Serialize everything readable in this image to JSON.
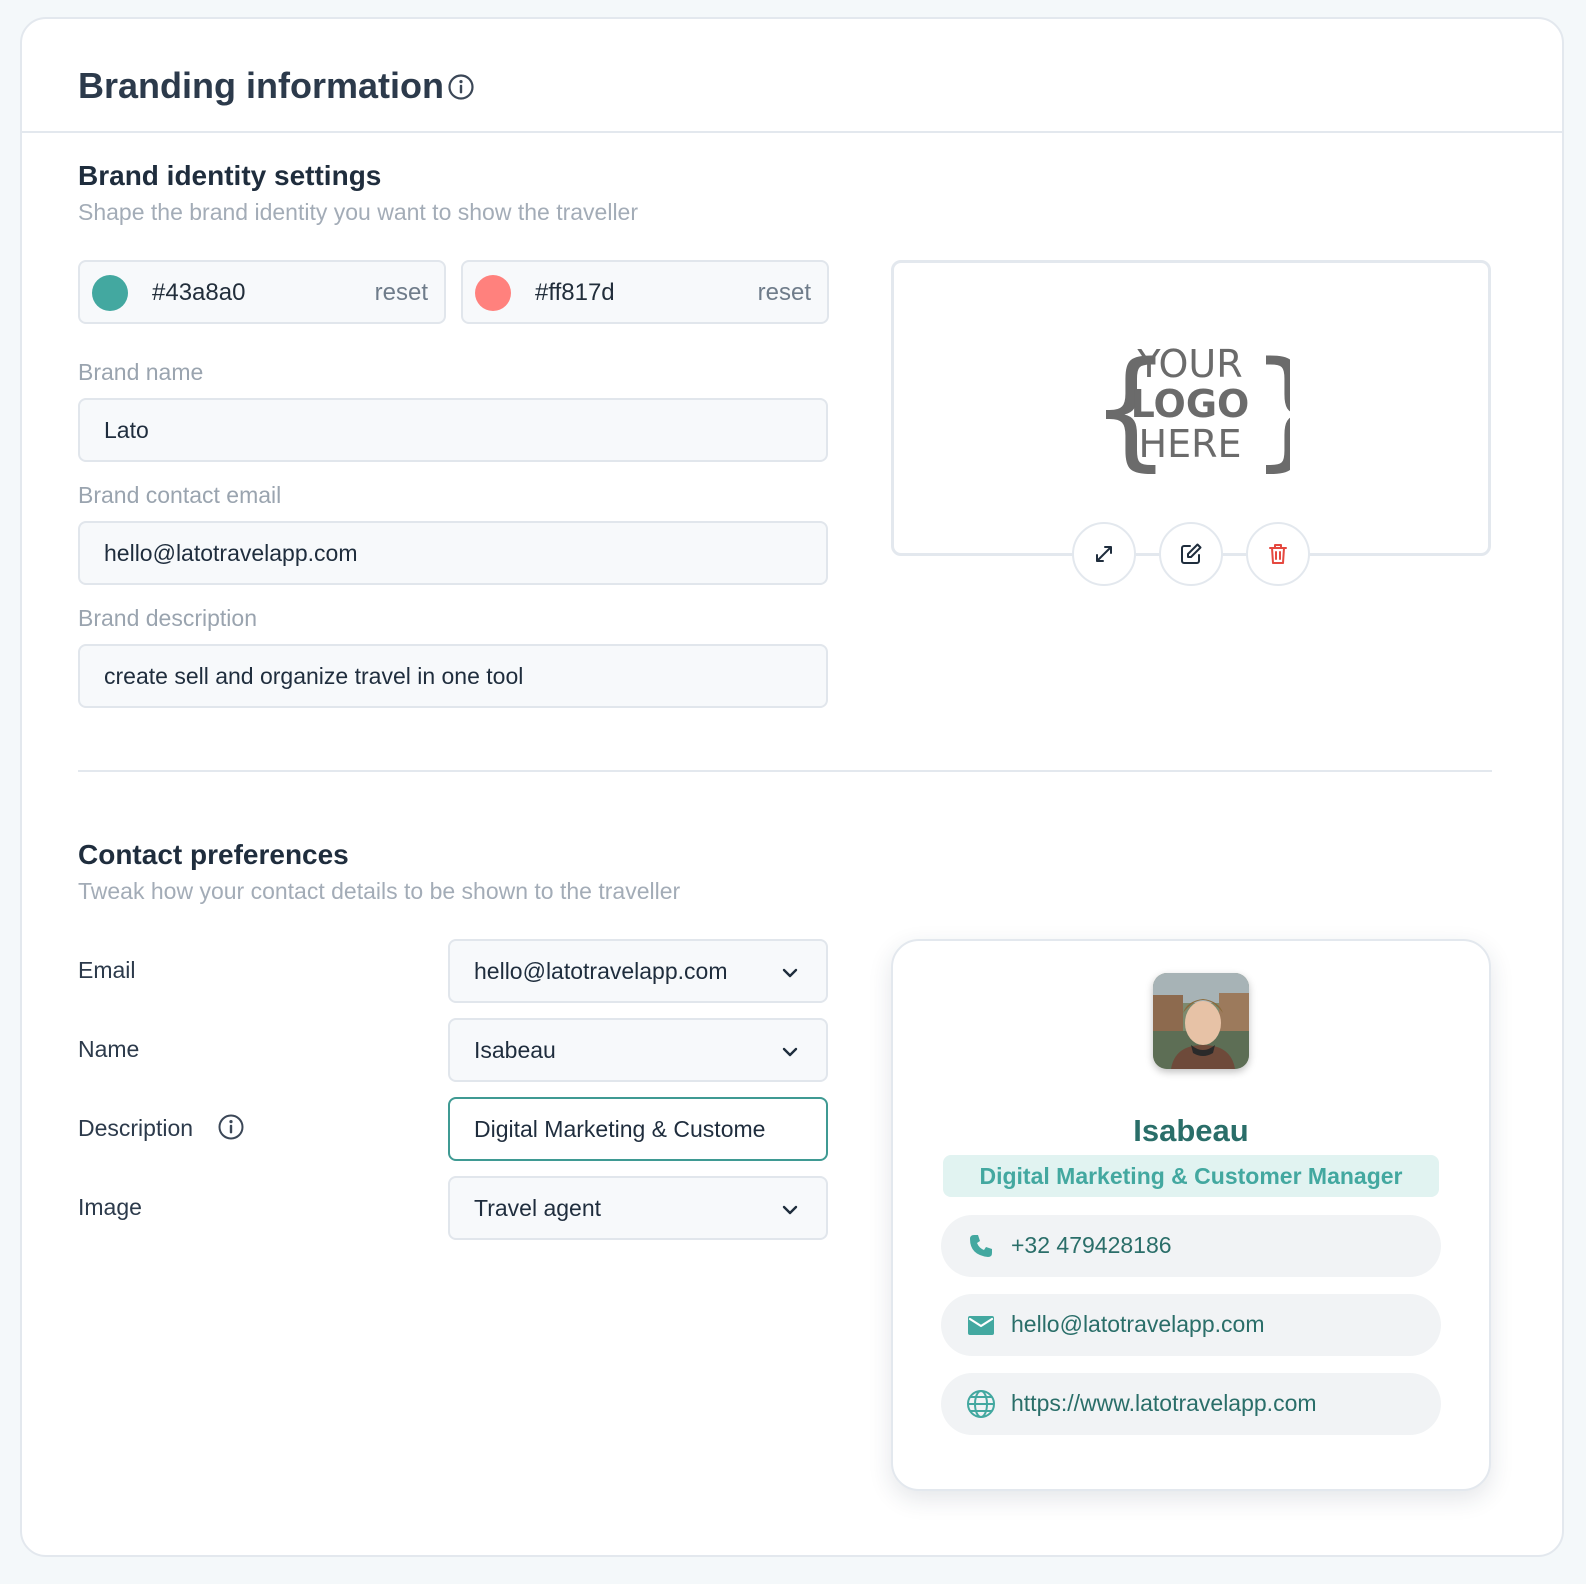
{
  "header": {
    "title": "Branding information",
    "info_icon": "info-icon"
  },
  "brand_identity": {
    "title": "Brand identity settings",
    "subtitle": "Shape the brand identity you want to show the traveller",
    "primary_color": {
      "value": "#43a8a0",
      "swatch": "#43a8a0",
      "reset_label": "reset"
    },
    "secondary_color": {
      "value": "#ff817d",
      "swatch": "#ff817d",
      "reset_label": "reset"
    },
    "brand_name": {
      "label": "Brand name",
      "value": "Lato"
    },
    "brand_email": {
      "label": "Brand contact email",
      "value": "hello@latotravelapp.com"
    },
    "brand_description": {
      "label": "Brand description",
      "value": "create sell and organize travel in one tool"
    },
    "logo": {
      "line1": "YOUR",
      "line2": "LOGO",
      "line3": "HERE",
      "actions": [
        "expand-icon",
        "edit-icon",
        "trash-icon"
      ]
    }
  },
  "contact_preferences": {
    "title": "Contact preferences",
    "subtitle": "Tweak how your contact details to be shown to the traveller",
    "email": {
      "label": "Email",
      "value": "hello@latotravelapp.com"
    },
    "name": {
      "label": "Name",
      "value": "Isabeau"
    },
    "description": {
      "label": "Description",
      "value": "Digital Marketing & Customer Manager"
    },
    "image": {
      "label": "Image",
      "value": "Travel agent"
    }
  },
  "contact_card": {
    "name": "Isabeau",
    "role": "Digital Marketing & Customer Manager",
    "phone": "+32 479428186",
    "email": "hello@latotravelapp.com",
    "website": "https://www.latotravelapp.com"
  },
  "colors": {
    "accent": "#43a8a0",
    "secondary": "#ff817d",
    "accent_dark": "#2a6e69",
    "danger": "#e5483f"
  }
}
